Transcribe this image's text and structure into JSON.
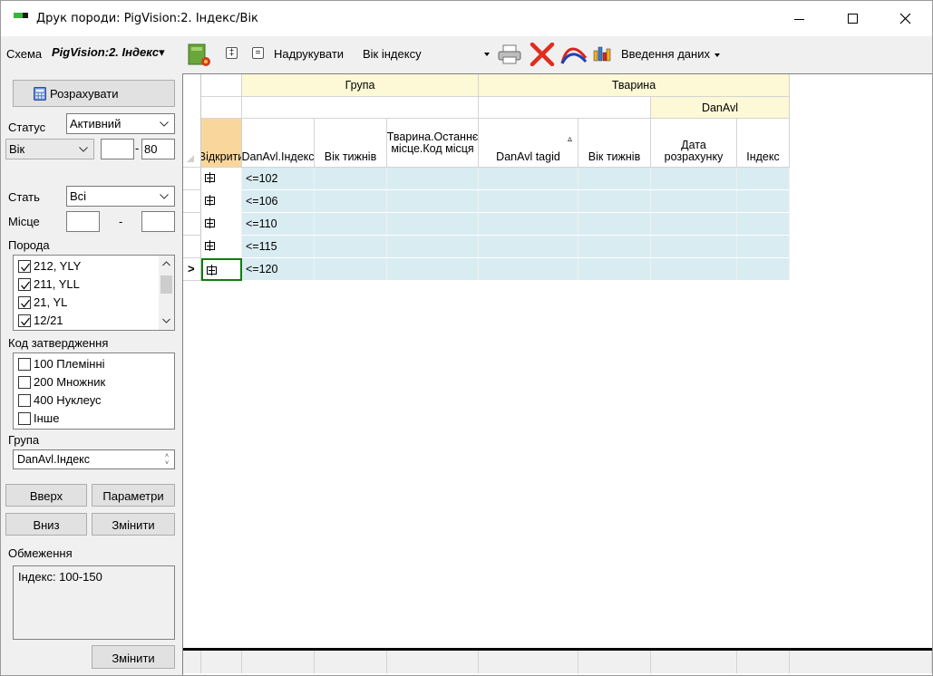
{
  "window": {
    "title": "Друк породи: PigVision:2. Індекс/Вік"
  },
  "toolbar": {
    "scheme_label": "Схема",
    "scheme_name": "PigVision:2. Індекс",
    "print_label": "Надрукувати",
    "print_option": "Вік індексу",
    "data_entry_label": "Введення даних"
  },
  "panel": {
    "calculate_label": "Розрахувати",
    "status_label": "Статус",
    "status_value": "Активний",
    "age_select": "Вік",
    "age_from": "",
    "age_to": "80",
    "age_sep": "-",
    "sex_label": "Стать",
    "sex_value": "Всі",
    "place_label": "Місце",
    "place_sep": "-",
    "breed_label": "Порода",
    "breeds": [
      {
        "label": "212, YLY",
        "checked": true
      },
      {
        "label": "211, YLL",
        "checked": true
      },
      {
        "label": "21, YL",
        "checked": true
      },
      {
        "label": "12/21",
        "checked": true
      }
    ],
    "approval_label": "Код затвердження",
    "approvals": [
      {
        "label": "100 Племінні",
        "checked": false
      },
      {
        "label": "200 Множник",
        "checked": false
      },
      {
        "label": "400 Нуклеус",
        "checked": false
      },
      {
        "label": "Інше",
        "checked": false
      }
    ],
    "group_label": "Група",
    "group_value": "DanAvl.Індекс",
    "up_label": "Вверх",
    "params_label": "Параметри",
    "down_label": "Вниз",
    "change_label": "Змінити",
    "restrictions_label": "Обмеження",
    "restrictions_text": "Індекс: 100-150",
    "change2_label": "Змінити"
  },
  "grid": {
    "band_group": "Група",
    "band_animal": "Тварина",
    "band_danavl": "DanAvl",
    "columns": [
      "Відкрити",
      "DanAvl.Індекс",
      "Вік тижнів",
      "Тварина.Останнє місце.Код місця",
      "DanAvl tagid",
      "Вік тижнів",
      "Дата розрахунку",
      "Індекс"
    ],
    "sort_indicator": "▵",
    "row_pointer": ">",
    "rows": [
      "<=102",
      "<=106",
      "<=110",
      "<=115",
      "<=120"
    ]
  },
  "colors": {
    "band": "#fdf8d5",
    "selected_header": "#f9d79c",
    "row": "#d9ecf2"
  }
}
